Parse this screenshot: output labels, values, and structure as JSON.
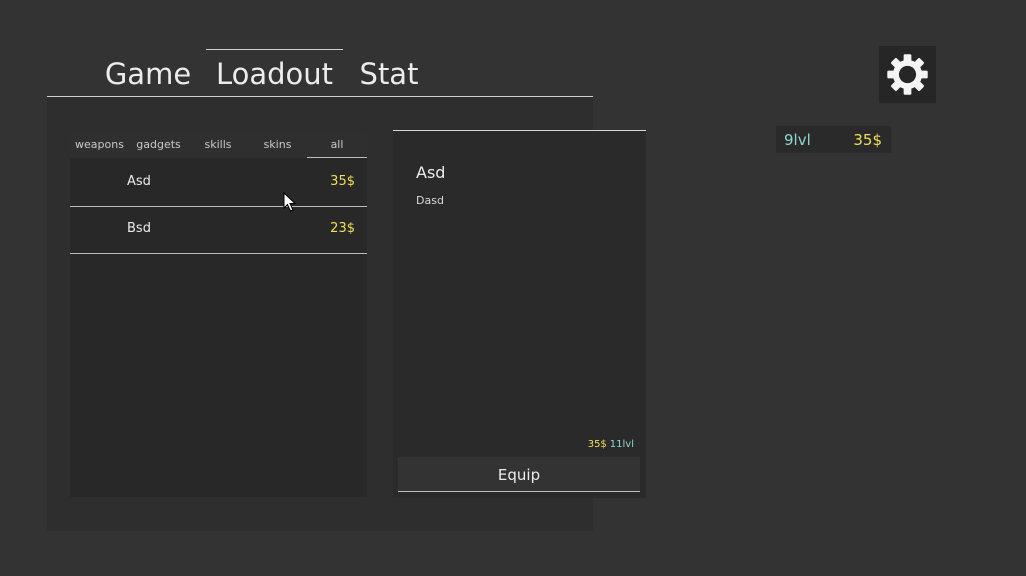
{
  "main_tabs": [
    {
      "label": "Game",
      "active": false
    },
    {
      "label": "Loadout",
      "active": true
    },
    {
      "label": "Stat",
      "active": false
    }
  ],
  "categories": [
    {
      "label": "weapons",
      "active": false
    },
    {
      "label": "gadgets",
      "active": false
    },
    {
      "label": "skills",
      "active": false
    },
    {
      "label": "skins",
      "active": false
    },
    {
      "label": "all",
      "active": true
    }
  ],
  "items": [
    {
      "name": "Asd",
      "price": "35$"
    },
    {
      "name": "Bsd",
      "price": "23$"
    }
  ],
  "detail": {
    "title": "Asd",
    "description": "Dasd",
    "price": "35$",
    "level": "11lvl",
    "equip_label": "Equip"
  },
  "player": {
    "level": "9lvl",
    "money": "35$"
  },
  "icons": {
    "settings": "gear-icon",
    "cursor": "mouse-cursor-icon"
  },
  "colors": {
    "money": "#f2df5e",
    "level": "#8fd6d0"
  }
}
